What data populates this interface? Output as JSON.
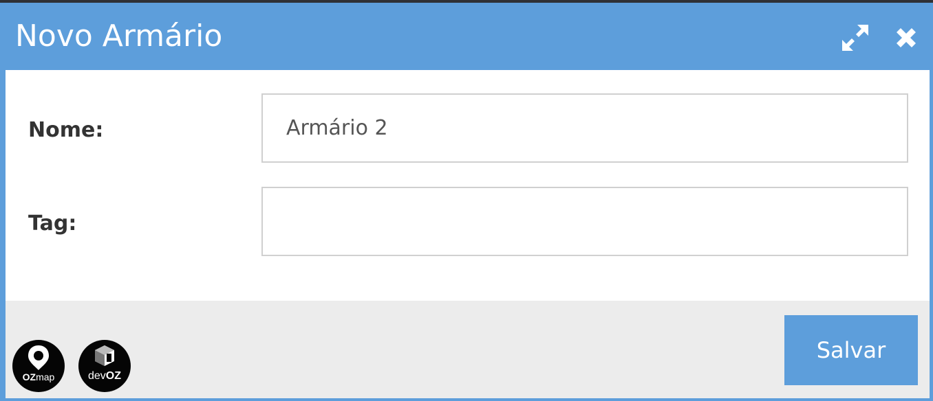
{
  "dialog": {
    "title": "Novo Armário",
    "expand_icon": "expand-arrows-icon",
    "close_icon": "close-x-icon"
  },
  "form": {
    "nome_label": "Nome:",
    "nome_value": "Armário 2",
    "tag_label": "Tag:",
    "tag_value": ""
  },
  "footer": {
    "save_label": "Salvar",
    "logos": [
      {
        "name": "ozmap-logo",
        "text_bold": "OZ",
        "text_light": "map"
      },
      {
        "name": "devoz-logo",
        "text_light": "dev",
        "text_bold": "OZ"
      }
    ]
  },
  "colors": {
    "header": "#5d9edb",
    "footer": "#ececec",
    "button": "#5d9edb"
  }
}
